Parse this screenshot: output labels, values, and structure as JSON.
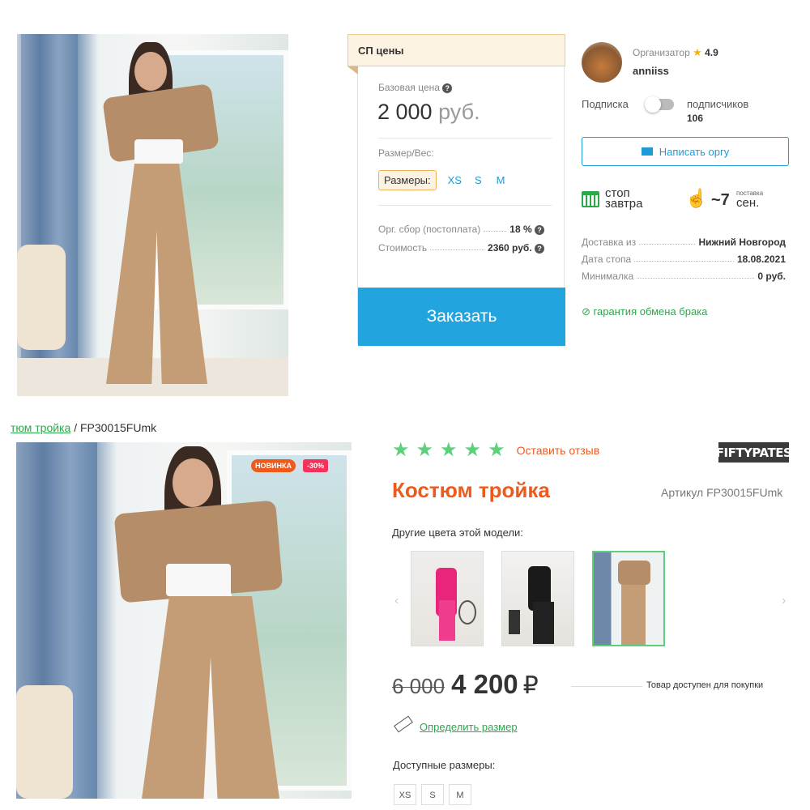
{
  "sp_panel": {
    "tab_label": "СП цены",
    "base_price_label": "Базовая цена",
    "base_price_value": "2 000",
    "base_price_currency": "руб.",
    "size_weight_label": "Размер/Вес:",
    "sizes_label": "Размеры:",
    "sizes": [
      "XS",
      "S",
      "M"
    ],
    "org_fee_label": "Орг. сбор (постоплата)",
    "org_fee_value": "18 %",
    "cost_label": "Стоимость",
    "cost_value": "2360 руб.",
    "order_button": "Заказать"
  },
  "organizer": {
    "role_label": "Организатор",
    "rating": "4.9",
    "name": "anniiss",
    "subscription_label": "Подписка",
    "subscribers_label": "подписчиков",
    "subscribers_count": "106",
    "message_button": "Написать оргу",
    "stop_label_1": "стоп",
    "stop_label_2": "завтра",
    "delivery_approx": "~7",
    "delivery_small": "поставка",
    "delivery_unit": "сен.",
    "details": [
      {
        "label": "Доставка из",
        "value": "Нижний Новгород"
      },
      {
        "label": "Дата стопа",
        "value": "18.08.2021"
      },
      {
        "label": "Минималка",
        "value": "0 руб."
      }
    ],
    "guarantee": "гарантия обмена брака"
  },
  "breadcrumb": {
    "link": "тюм тройка",
    "separator": "/",
    "current": "FP30015FUmk"
  },
  "product": {
    "badge_new": "НОВИНКА",
    "badge_discount": "-30%",
    "review_link": "Оставить отзыв",
    "brand": "FIFTYPATES",
    "title": "Костюм тройка",
    "article": "Артикул FP30015FUmk",
    "other_colors_label": "Другие цвета этой модели:",
    "old_price": "6 000",
    "price": "4 200",
    "currency_symbol": "₽",
    "availability": "Товар доступен для покупки",
    "size_link": "Определить размер",
    "available_sizes_label": "Доступные размеры:",
    "available_sizes": [
      "XS",
      "S",
      "M"
    ],
    "rating_stars": 5
  },
  "colors": {
    "accent_blue": "#1e9bd7",
    "accent_orange": "#ee5a1c",
    "accent_green": "#2ca84a",
    "star_green": "#5cd07a"
  }
}
